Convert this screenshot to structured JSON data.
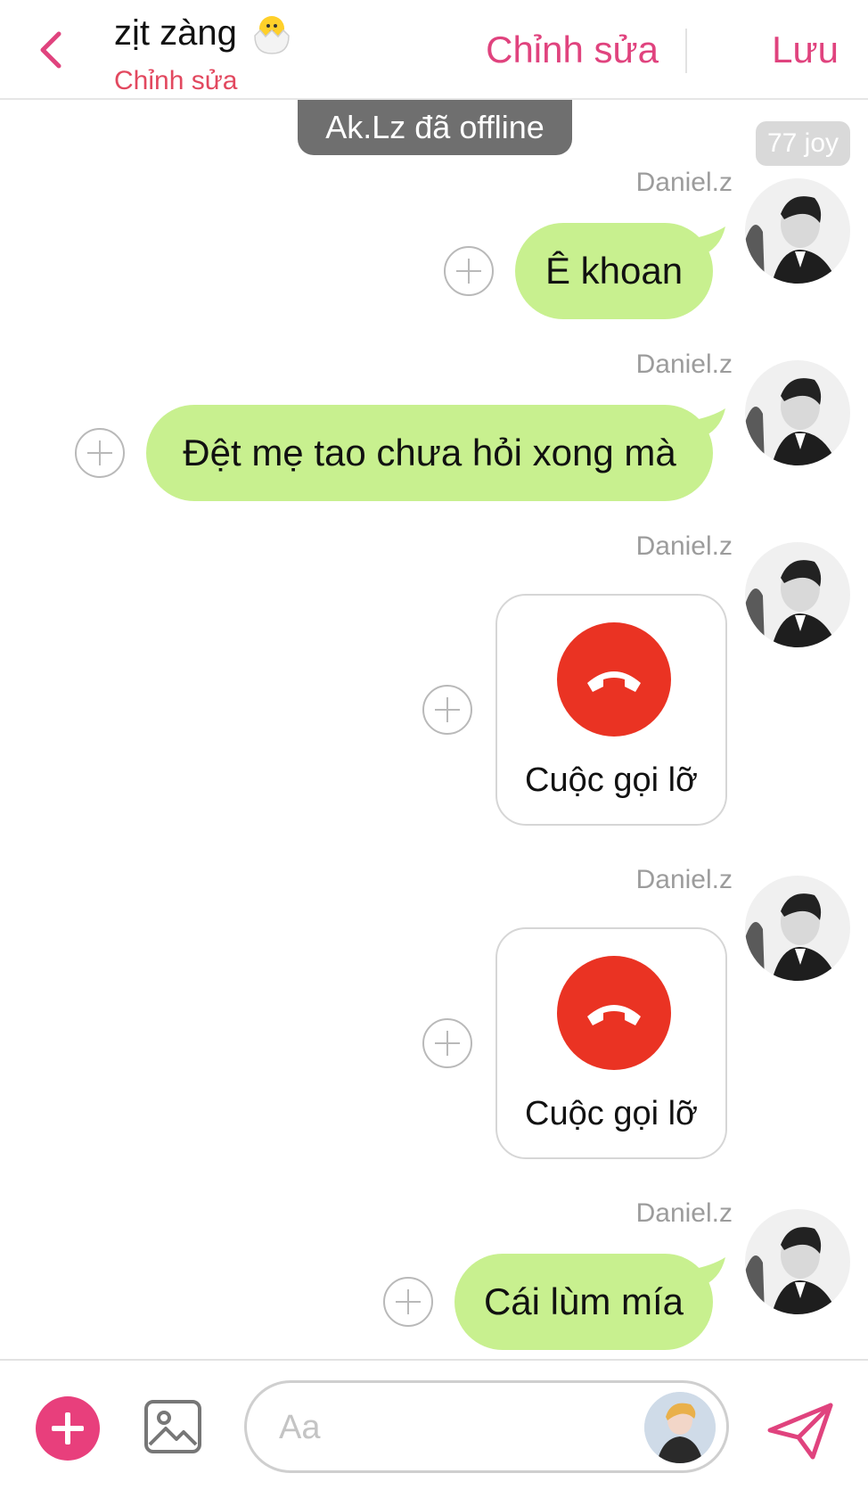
{
  "header": {
    "title": "zịt zàng",
    "title_emoji": "🐣",
    "subtitle": "Chỉnh sửa",
    "edit_label": "Chỉnh sửa",
    "save_label": "Lưu"
  },
  "status": {
    "offline_notice": "Ak.Lz đã offline",
    "joy_count": "77 joy"
  },
  "messages": [
    {
      "type": "text",
      "sender": "Daniel.z",
      "text": "Ê khoan"
    },
    {
      "type": "text",
      "sender": "Daniel.z",
      "text": "Đệt mẹ tao chưa hỏi xong mà"
    },
    {
      "type": "call",
      "sender": "Daniel.z",
      "text": "Cuộc gọi lỡ"
    },
    {
      "type": "call",
      "sender": "Daniel.z",
      "text": "Cuộc gọi lỡ"
    },
    {
      "type": "text",
      "sender": "Daniel.z",
      "text": "Cái lùm mía"
    }
  ],
  "composer": {
    "placeholder": "Aa"
  },
  "colors": {
    "accent": "#e0437e",
    "subtitle": "#e2485f",
    "bubble": "#c8f08f",
    "missed_call": "#ea3323"
  },
  "icons": {
    "back": "chevron-left-icon",
    "add": "plus-circle-icon",
    "image": "image-icon",
    "send": "paper-plane-icon",
    "missed_call": "phone-hangup-icon"
  }
}
